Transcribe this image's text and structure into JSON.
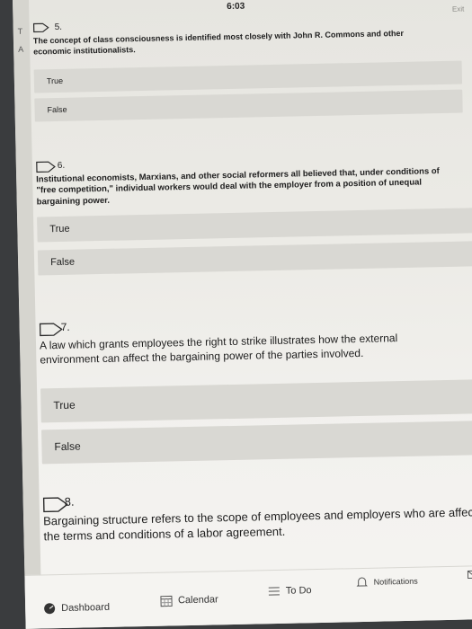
{
  "status": {
    "time": "6:03"
  },
  "header": {
    "exit_label": "Exit"
  },
  "sidebar_letters": [
    "T",
    "A"
  ],
  "questions": [
    {
      "number": "5.",
      "text": "The concept of class consciousness is identified most closely with John R. Commons and other economic institutionalists.",
      "options": [
        "True",
        "False"
      ]
    },
    {
      "number": "6.",
      "text": "Institutional economists, Marxians, and other social reformers all believed that, under conditions of \"free competition,\" individual workers would deal with the employer from a position of unequal bargaining power.",
      "options": [
        "True",
        "False"
      ]
    },
    {
      "number": "7.",
      "text": "A law which grants employees the right to strike illustrates how the external environment can affect the bargaining power of the parties involved.",
      "options": [
        "True",
        "False"
      ]
    },
    {
      "number": "8.",
      "text": "Bargaining structure refers to the scope of employees and employers who are affect by the terms and conditions of a labor agreement.",
      "options": []
    }
  ],
  "bottom_nav": {
    "dashboard": "Dashboard",
    "calendar": "Calendar",
    "todo": "To Do",
    "notifications": "Notifications"
  }
}
